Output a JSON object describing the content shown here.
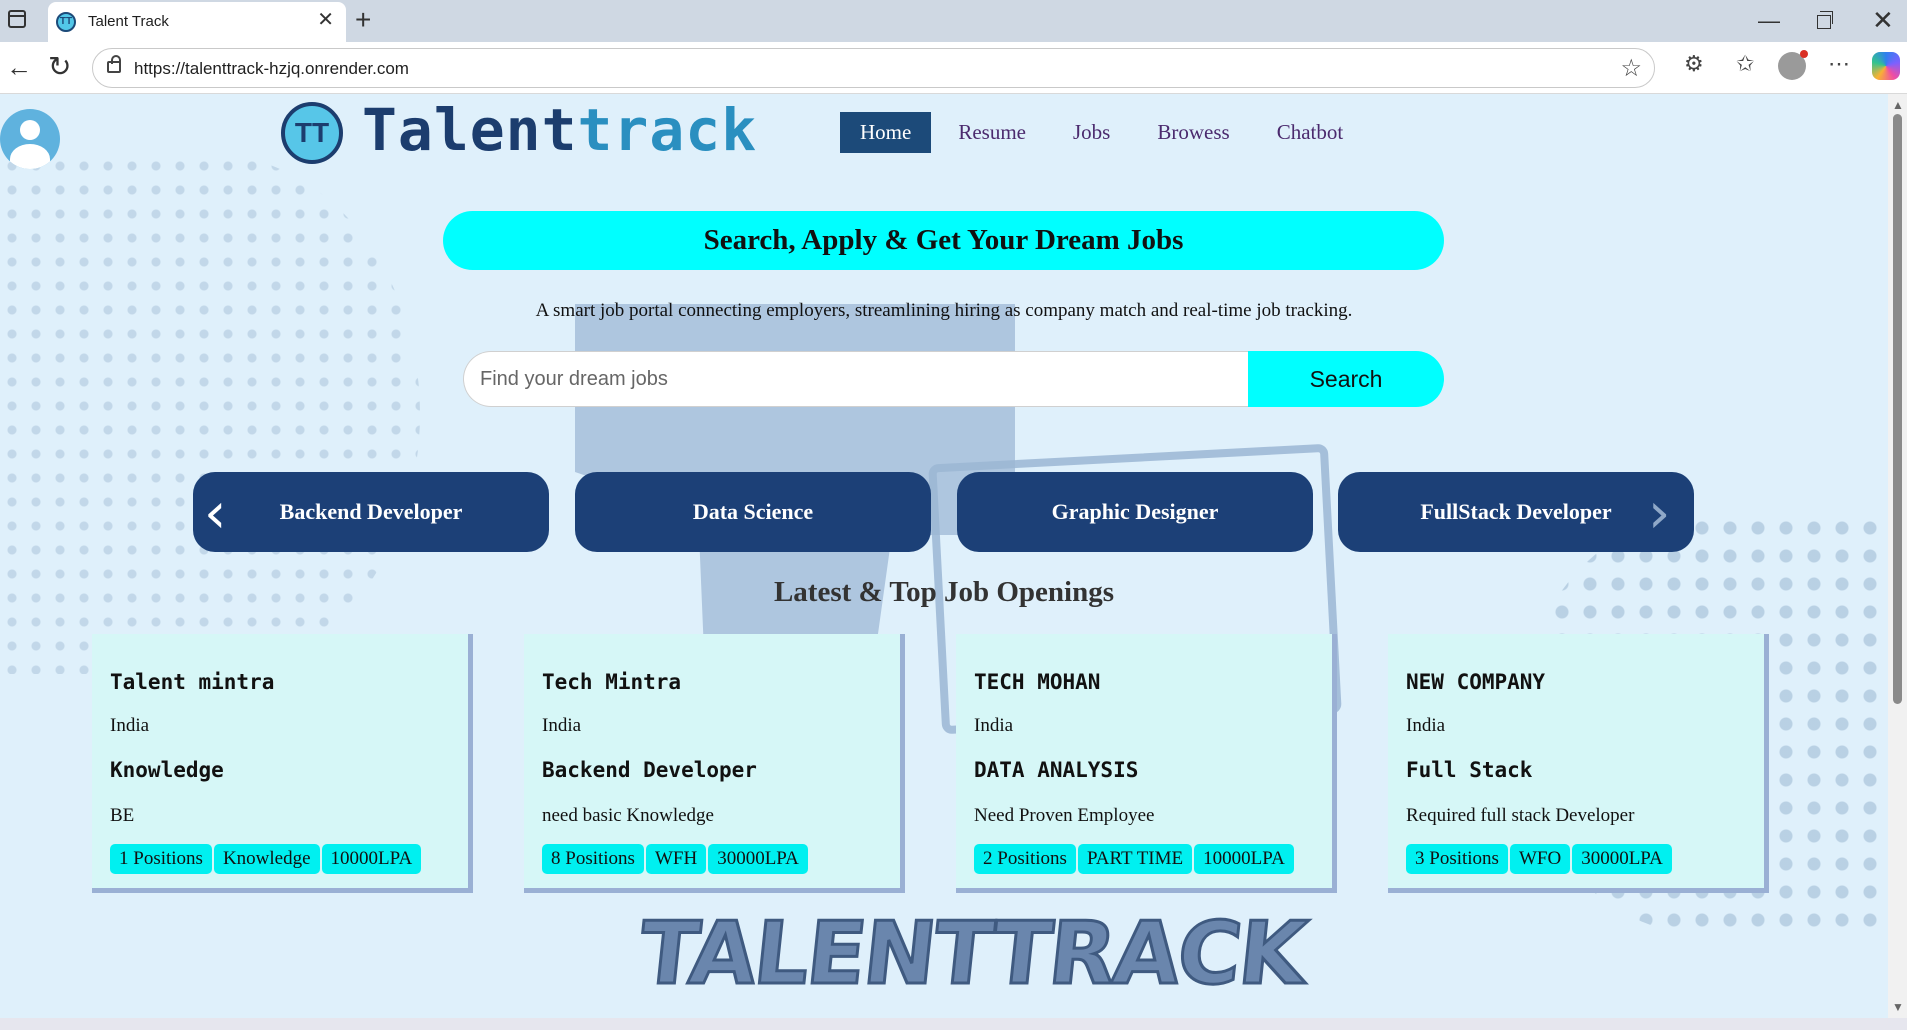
{
  "browser": {
    "tab_title": "Talent Track",
    "favicon_text": "TT",
    "url": "https://talenttrack-hzjq.onrender.com"
  },
  "header": {
    "logo_mark": "TT",
    "logo_primary": "Talent",
    "logo_accent": "track",
    "nav": [
      {
        "label": "Home",
        "active": true
      },
      {
        "label": "Resume",
        "active": false
      },
      {
        "label": "Jobs",
        "active": false
      },
      {
        "label": "Browess",
        "active": false
      },
      {
        "label": "Chatbot",
        "active": false
      }
    ]
  },
  "hero": {
    "banner": "Search, Apply & Get Your Dream Jobs",
    "tagline": "A smart job portal connecting employers, streamlining hiring as company match and real-time job tracking."
  },
  "search": {
    "placeholder": "Find your dream jobs",
    "value": "",
    "button_label": "Search"
  },
  "categories": [
    "Backend Developer",
    "Data Science",
    "Graphic Designer",
    "FullStack Developer"
  ],
  "section_title": "Latest & Top Job Openings",
  "jobs": [
    {
      "company": "Talent mintra",
      "location": "India",
      "role": "Knowledge",
      "description": "BE",
      "tags": [
        "1 Positions",
        "Knowledge",
        "10000LPA"
      ]
    },
    {
      "company": "Tech Mintra",
      "location": "India",
      "role": "Backend Developer",
      "description": "need basic Knowledge",
      "tags": [
        "8 Positions",
        "WFH",
        "30000LPA"
      ]
    },
    {
      "company": "TECH MOHAN",
      "location": "India",
      "role": "DATA ANALYSIS",
      "description": "Need Proven Employee",
      "tags": [
        "2 Positions",
        "PART TIME",
        "10000LPA"
      ]
    },
    {
      "company": "NEW COMPANY",
      "location": "India",
      "role": "Full Stack",
      "description": "Required full stack Developer",
      "tags": [
        "3 Positions",
        "WFO",
        "30000LPA"
      ]
    }
  ],
  "footer_logo": "TALENTTRACK",
  "colors": {
    "page_bg": "#dff0fb",
    "accent_cyan": "#00ffff",
    "navy": "#1c4077",
    "card_bg": "#d6f7f7"
  },
  "icons": [
    "sidebar-toggle-icon",
    "close-icon",
    "plus-icon",
    "back-arrow-icon",
    "reload-icon",
    "lock-icon",
    "star-icon",
    "extensions-icon",
    "favorites-icon",
    "profile-icon",
    "more-icon",
    "copilot-icon",
    "user-avatar-icon",
    "chevron-left-icon",
    "chevron-right-icon"
  ]
}
